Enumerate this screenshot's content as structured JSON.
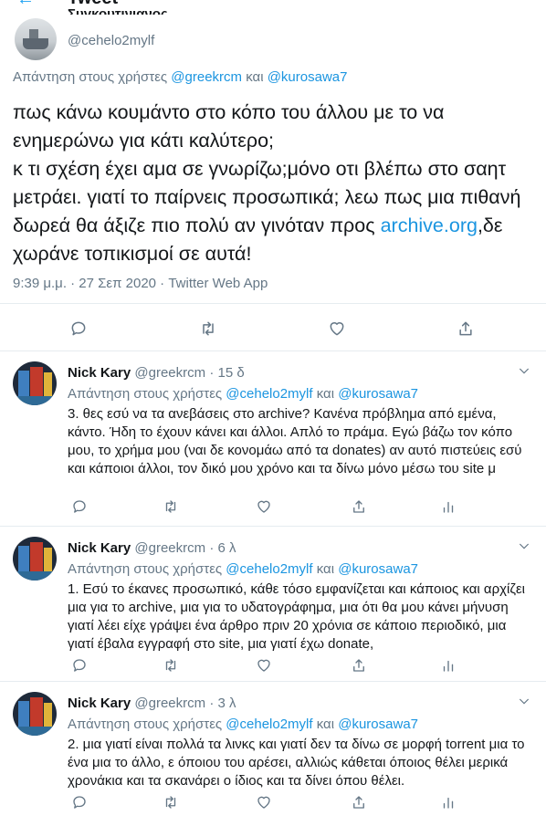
{
  "header": {
    "back_glyph": "←",
    "title": "Tweet"
  },
  "main_tweet": {
    "display_name": "Συγκουτινιανος",
    "handle": "@cehelo2mylf",
    "reply_prefix": "Απάντηση στους χρήστες",
    "reply_user1": "@greekrcm",
    "reply_and": "και",
    "reply_user2": "@kurosawa7",
    "text_before_link": "πως κάνω κουμάντο στο κόπο του άλλου με το να ενημερώνω για κάτι καλύτερο;\nκ τι σχέση έχει αμα σε γνωρίζω;μόνο οτι βλέπω στο σαητ μετράει. γιατί το παίρνεις προσωπικά; λεω πως μια πιθανή δωρεά θα άξιζε πιο πολύ αν γινόταν προς ",
    "link_text": "archive.org",
    "text_after_link": ",δε χωράνε τοπικισμοί σε αυτά!",
    "meta": "9:39 μ.μ. · 27 Σεπ 2020 · Twitter Web App",
    "icons": [
      "reply-icon",
      "retweet-icon",
      "like-icon",
      "share-icon"
    ]
  },
  "replies": [
    {
      "name": "Nick Kary",
      "handle": "@greekrcm",
      "dot": "·",
      "time": "15 δ",
      "reply_prefix": "Απάντηση στους χρήστες",
      "user1": "@cehelo2mylf",
      "and": "και",
      "user2": "@kurosawa7",
      "text": "3. θες εσύ να τα ανεβάσεις στο archive? Κανένα πρόβλημα από εμένα, κάντο. Ήδη το έχουν κάνει και άλλοι.  Απλό το πράμα. Εγώ βάζω τον κόπο μου, το χρήμα μου (ναι δε κονομάω από τα donates) αν αυτό πιστεύεις εσύ και κάποιοι άλλοι, τον δικό μου χρόνο και τα δίνω μόνο μέσω του site μ"
    },
    {
      "name": "Nick Kary",
      "handle": "@greekrcm",
      "dot": "·",
      "time": "6 λ",
      "reply_prefix": "Απάντηση στους χρήστες",
      "user1": "@cehelo2mylf",
      "and": "και",
      "user2": "@kurosawa7",
      "text": "1. Εσύ το έκανες προσωπικό, κάθε τόσο εμφανίζεται και κάποιος και αρχίζει μια για το archive, μια για το υδατογράφημα, μια ότι θα μου κάνει μήνυση γιατί λέει είχε γράψει ένα άρθρο πριν 20 χρόνια σε κάποιο περιοδικό, μια γιατί έβαλα εγγραφή στο site, μια γιατί έχω donate,"
    },
    {
      "name": "Nick Kary",
      "handle": "@greekrcm",
      "dot": "·",
      "time": "3 λ",
      "reply_prefix": "Απάντηση στους χρήστες",
      "user1": "@cehelo2mylf",
      "and": "και",
      "user2": "@kurosawa7",
      "text": "2. μια γιατί είναι πολλά τα λινκς και γιατί δεν τα δίνω σε μορφή torrent μια το ένα μια το άλλο, ε όποιου του αρέσει, αλλιώς κάθεται όποιος θέλει μερικά χρονάκια και τα σκανάρει ο ίδιος και τα δίνει όπου θέλει."
    }
  ],
  "colors": {
    "link": "#1b95e0",
    "secondary_text": "#657786",
    "text": "#14171a",
    "divider": "#e6ecf0"
  }
}
